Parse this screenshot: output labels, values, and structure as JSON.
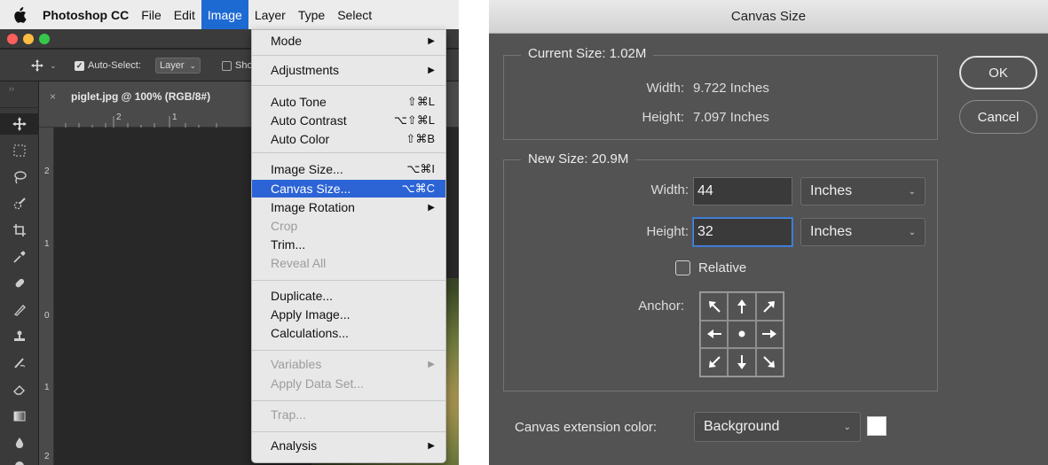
{
  "menubar": {
    "app_name": "Photoshop CC",
    "items": [
      "File",
      "Edit",
      "Image",
      "Layer",
      "Type",
      "Select"
    ],
    "active_item": "Image"
  },
  "options_bar": {
    "auto_select_label": "Auto-Select:",
    "auto_select_value": "Layer",
    "show_label": "Sho"
  },
  "document": {
    "tab_title": "piglet.jpg @ 100% (RGB/8#)"
  },
  "ruler": {
    "h_ticks": [
      "2",
      "1"
    ],
    "v_ticks": [
      "2",
      "1",
      "0",
      "1",
      "2"
    ]
  },
  "image_menu": {
    "items": [
      {
        "label": "Mode",
        "submenu": true
      },
      {
        "label": "Adjustments",
        "submenu": true
      },
      {
        "label": "Auto Tone",
        "shortcut": "⇧⌘L"
      },
      {
        "label": "Auto Contrast",
        "shortcut": "⌥⇧⌘L"
      },
      {
        "label": "Auto Color",
        "shortcut": "⇧⌘B"
      },
      {
        "label": "Image Size...",
        "shortcut": "⌥⌘I"
      },
      {
        "label": "Canvas Size...",
        "shortcut": "⌥⌘C",
        "selected": true
      },
      {
        "label": "Image Rotation",
        "submenu": true
      },
      {
        "label": "Crop",
        "disabled": true
      },
      {
        "label": "Trim..."
      },
      {
        "label": "Reveal All",
        "disabled": true
      },
      {
        "label": "Duplicate..."
      },
      {
        "label": "Apply Image..."
      },
      {
        "label": "Calculations..."
      },
      {
        "label": "Variables",
        "submenu": true,
        "disabled": true
      },
      {
        "label": "Apply Data Set...",
        "disabled": true
      },
      {
        "label": "Trap...",
        "disabled": true
      },
      {
        "label": "Analysis",
        "submenu": true
      }
    ]
  },
  "dialog": {
    "title": "Canvas Size",
    "current_size": {
      "legend": "Current Size: 1.02M",
      "width_label": "Width:",
      "width_value": "9.722 Inches",
      "height_label": "Height:",
      "height_value": "7.097 Inches"
    },
    "new_size": {
      "legend": "New Size: 20.9M",
      "width_label": "Width:",
      "width_value": "44",
      "width_unit": "Inches",
      "height_label": "Height:",
      "height_value": "32",
      "height_unit": "Inches",
      "relative_label": "Relative",
      "relative_checked": false,
      "anchor_label": "Anchor:"
    },
    "ok_label": "OK",
    "cancel_label": "Cancel",
    "extension_color_label": "Canvas extension color:",
    "extension_color_value": "Background",
    "extension_swatch_color": "#ffffff"
  },
  "colors": {
    "menu_highlight": "#2c64d6",
    "menubar_active": "#1e6ad3",
    "dialog_bg": "#535353",
    "focus_ring": "#4a8ae6"
  }
}
